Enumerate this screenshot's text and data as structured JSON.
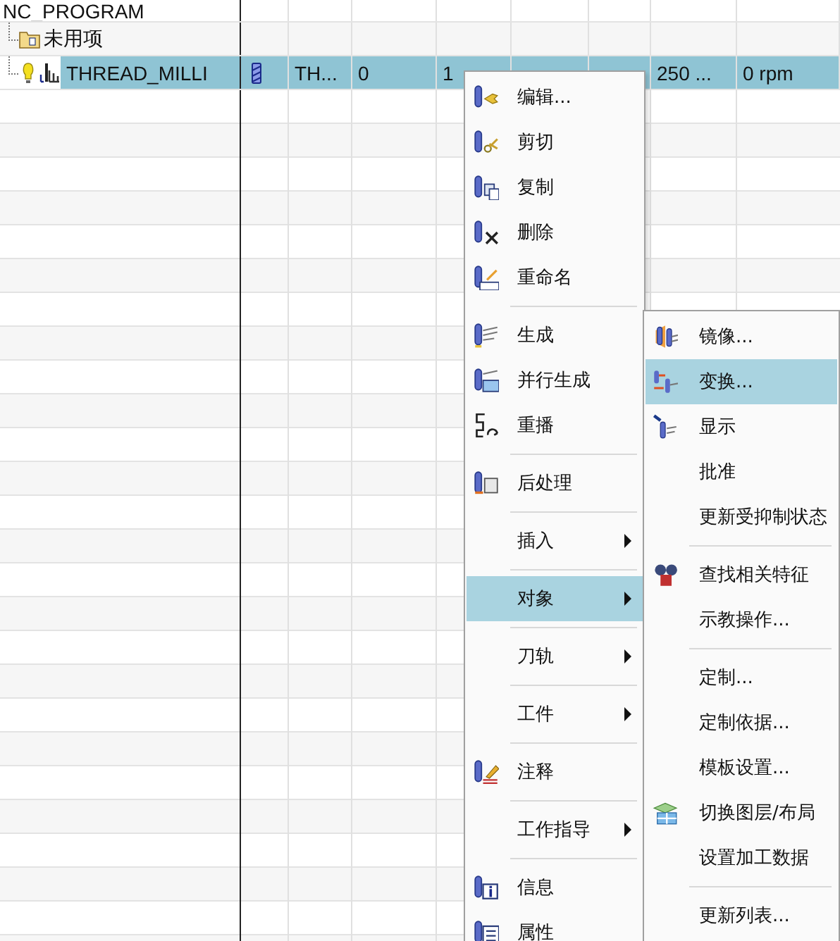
{
  "tree": {
    "rows": [
      {
        "name": "NC_PROGRAM",
        "children": [
          {
            "name": "未用项",
            "kind": "folder",
            "selected": false
          },
          {
            "name": "THREAD_MILLI",
            "kind": "operation",
            "selected": true,
            "cells": {
              "column_3": "TH...",
              "column_4": "0",
              "column_5": "1",
              "column_8": "250 ...",
              "column_9": "0 rpm"
            }
          }
        ]
      }
    ]
  },
  "context_menu": {
    "items": [
      {
        "kind": "item",
        "label": "编辑...",
        "icon": true,
        "submenu": false,
        "selected": false
      },
      {
        "kind": "item",
        "label": "剪切",
        "icon": true,
        "submenu": false,
        "selected": false
      },
      {
        "kind": "item",
        "label": "复制",
        "icon": true,
        "submenu": false,
        "selected": false
      },
      {
        "kind": "item",
        "label": "删除",
        "icon": true,
        "submenu": false,
        "selected": false
      },
      {
        "kind": "item",
        "label": "重命名",
        "icon": true,
        "submenu": false,
        "selected": false
      },
      {
        "kind": "separator"
      },
      {
        "kind": "item",
        "label": "生成",
        "icon": true,
        "submenu": false,
        "selected": false
      },
      {
        "kind": "item",
        "label": "并行生成",
        "icon": true,
        "submenu": false,
        "selected": false
      },
      {
        "kind": "item",
        "label": "重播",
        "icon": true,
        "submenu": false,
        "selected": false
      },
      {
        "kind": "separator"
      },
      {
        "kind": "item",
        "label": "后处理",
        "icon": true,
        "submenu": false,
        "selected": false
      },
      {
        "kind": "separator"
      },
      {
        "kind": "item",
        "label": "插入",
        "icon": false,
        "submenu": true,
        "selected": false
      },
      {
        "kind": "separator"
      },
      {
        "kind": "item",
        "label": "对象",
        "icon": false,
        "submenu": true,
        "selected": true
      },
      {
        "kind": "separator"
      },
      {
        "kind": "item",
        "label": "刀轨",
        "icon": false,
        "submenu": true,
        "selected": false
      },
      {
        "kind": "separator"
      },
      {
        "kind": "item",
        "label": "工件",
        "icon": false,
        "submenu": true,
        "selected": false
      },
      {
        "kind": "separator"
      },
      {
        "kind": "item",
        "label": "注释",
        "icon": true,
        "submenu": false,
        "selected": false
      },
      {
        "kind": "separator"
      },
      {
        "kind": "item",
        "label": "工作指导",
        "icon": false,
        "submenu": true,
        "selected": false
      },
      {
        "kind": "separator"
      },
      {
        "kind": "item",
        "label": "信息",
        "icon": true,
        "submenu": false,
        "selected": false
      },
      {
        "kind": "item",
        "label": "属性",
        "icon": true,
        "submenu": false,
        "selected": false
      }
    ]
  },
  "submenu": {
    "items": [
      {
        "kind": "item",
        "label": "镜像...",
        "icon": true,
        "submenu": false,
        "selected": false
      },
      {
        "kind": "item",
        "label": "变换...",
        "icon": true,
        "submenu": false,
        "selected": true
      },
      {
        "kind": "item",
        "label": "显示",
        "icon": true,
        "submenu": false,
        "selected": false
      },
      {
        "kind": "item",
        "label": "批准",
        "icon": false,
        "submenu": false,
        "selected": false
      },
      {
        "kind": "item",
        "label": "更新受抑制状态",
        "icon": false,
        "submenu": false,
        "selected": false
      },
      {
        "kind": "separator"
      },
      {
        "kind": "item",
        "label": "查找相关特征",
        "icon": true,
        "submenu": false,
        "selected": false
      },
      {
        "kind": "item",
        "label": "示教操作...",
        "icon": false,
        "submenu": false,
        "selected": false
      },
      {
        "kind": "separator"
      },
      {
        "kind": "item",
        "label": "定制...",
        "icon": false,
        "submenu": false,
        "selected": false
      },
      {
        "kind": "item",
        "label": "定制依据...",
        "icon": false,
        "submenu": false,
        "selected": false
      },
      {
        "kind": "item",
        "label": "模板设置...",
        "icon": false,
        "submenu": false,
        "selected": false
      },
      {
        "kind": "item",
        "label": "切换图层/布局",
        "icon": true,
        "submenu": false,
        "selected": false
      },
      {
        "kind": "item",
        "label": "设置加工数据",
        "icon": false,
        "submenu": false,
        "selected": false
      },
      {
        "kind": "separator"
      },
      {
        "kind": "item",
        "label": "更新列表...",
        "icon": false,
        "submenu": false,
        "selected": false
      }
    ]
  }
}
